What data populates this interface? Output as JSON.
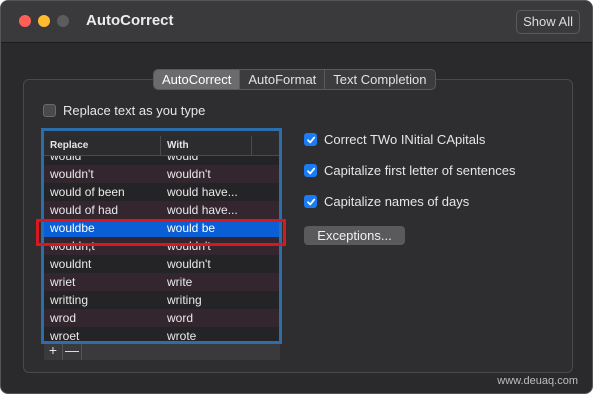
{
  "window": {
    "title": "AutoCorrect",
    "show_all": "Show All"
  },
  "tabs": [
    {
      "label": "AutoCorrect",
      "active": true
    },
    {
      "label": "AutoFormat",
      "active": false
    },
    {
      "label": "Text Completion",
      "active": false
    }
  ],
  "replace_text": {
    "label": "Replace text as you type",
    "checked": false
  },
  "table": {
    "headers": [
      "Replace",
      "With"
    ],
    "rows": [
      [
        "would",
        "would"
      ],
      [
        "wouldn't",
        "wouldn't"
      ],
      [
        "would of been",
        "would have..."
      ],
      [
        "would of had",
        "would have..."
      ],
      [
        "wouldbe",
        "would be"
      ],
      [
        "wouldn;t",
        "wouldn't"
      ],
      [
        "wouldnt",
        "wouldn't"
      ],
      [
        "wriet",
        "write"
      ],
      [
        "writting",
        "writing"
      ],
      [
        "wrod",
        "word"
      ],
      [
        "wroet",
        "wrote"
      ]
    ],
    "selected_row": 4
  },
  "options": [
    {
      "label": "Correct TWo INitial CApitals",
      "checked": true
    },
    {
      "label": "Capitalize first letter of sentences",
      "checked": true
    },
    {
      "label": "Capitalize names of days",
      "checked": true
    }
  ],
  "exceptions_button": "Exceptions...",
  "add_label": "+",
  "remove_label": "—",
  "watermark": "www.deuaq.com",
  "colors": {
    "accent": "#1a7cf5",
    "selection": "#0a5fd6",
    "highlight_red": "#d7191f",
    "highlight_blue": "#2c6eab"
  }
}
